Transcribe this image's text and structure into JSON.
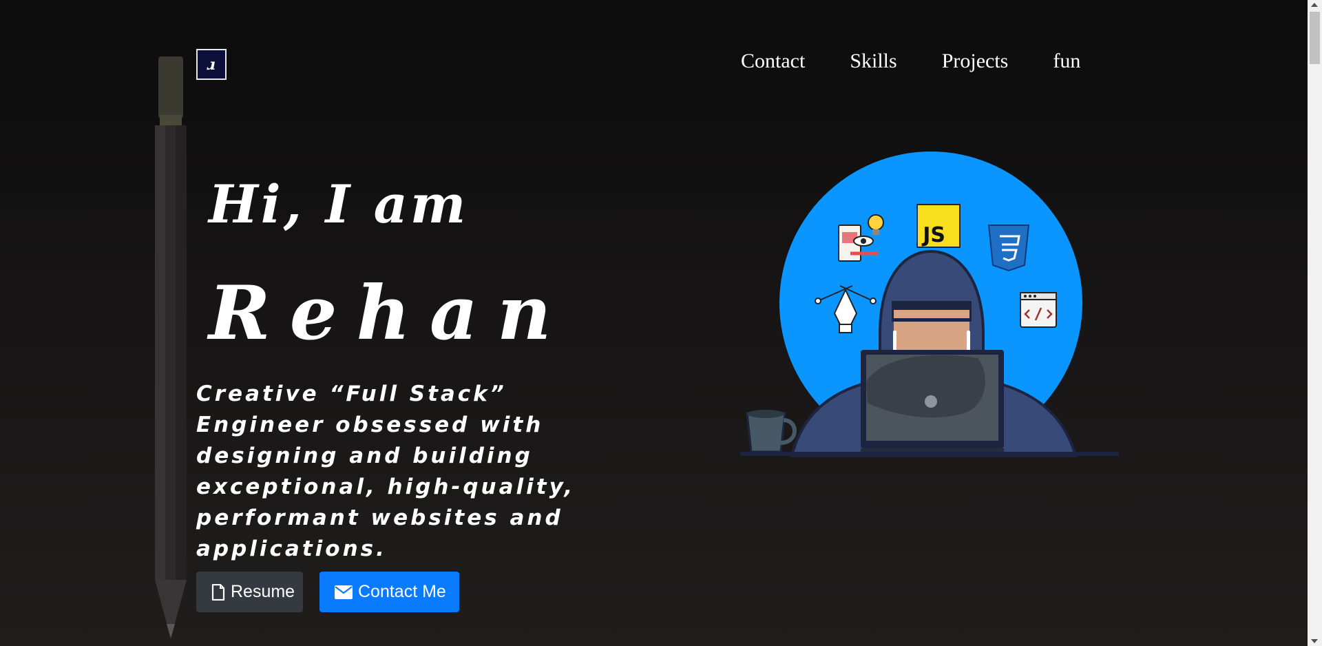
{
  "logo": {
    "glyph": "ɹ"
  },
  "nav": {
    "items": [
      {
        "label": "Contact"
      },
      {
        "label": "Skills"
      },
      {
        "label": "Projects"
      },
      {
        "label": "fun"
      }
    ]
  },
  "hero": {
    "greeting": "Hi, I am",
    "name": "Rehan",
    "tagline": "Creative “Full Stack” Engineer obsessed with designing and building exceptional, high-quality, performant websites and applications.",
    "resume_label": "Resume",
    "contact_label": "Contact Me"
  },
  "illustration": {
    "badges": [
      "JS"
    ]
  },
  "colors": {
    "background": "#141212",
    "resume_button": "#343a40",
    "contact_button": "#0a7aff",
    "illustration_circle": "#0a95ff",
    "hoodie": "#374a78",
    "js_badge": "#f7df1e",
    "css_badge": "#1f6fc4"
  },
  "icons": {
    "resume": "file-icon",
    "contact": "envelope-icon"
  }
}
